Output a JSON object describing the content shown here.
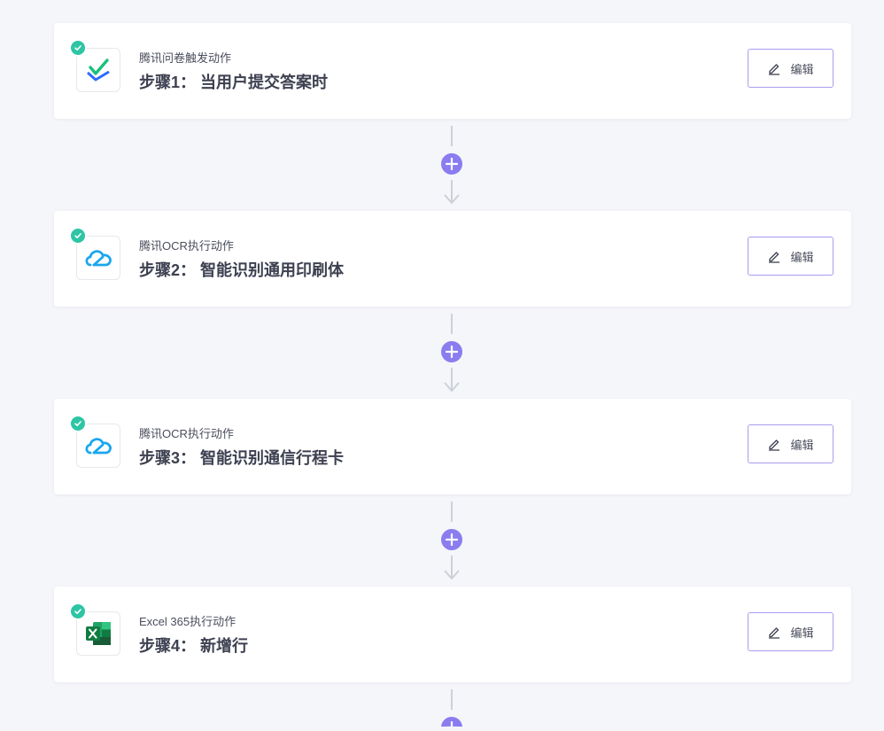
{
  "steps": [
    {
      "subtitle": "腾讯问卷触发动作",
      "title": "步骤1： 当用户提交答案时",
      "icon": "tencent-survey-icon",
      "edit_label": "编辑"
    },
    {
      "subtitle": "腾讯OCR执行动作",
      "title": "步骤2： 智能识别通用印刷体",
      "icon": "tencent-cloud-icon",
      "edit_label": "编辑"
    },
    {
      "subtitle": "腾讯OCR执行动作",
      "title": "步骤3： 智能识别通信行程卡",
      "icon": "tencent-cloud-icon",
      "edit_label": "编辑"
    },
    {
      "subtitle": "Excel 365执行动作",
      "title": "步骤4： 新增行",
      "icon": "excel-icon",
      "edit_label": "编辑"
    }
  ],
  "colors": {
    "accent": "#8b7cf0",
    "success": "#2ec5a4",
    "background": "#f5f6fa"
  }
}
